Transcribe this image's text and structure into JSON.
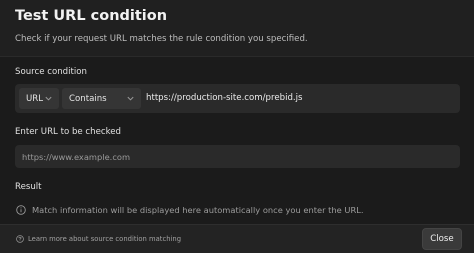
{
  "dialog": {
    "title": "Test URL condition",
    "subtitle": "Check if your request URL matches the rule condition you specified."
  },
  "source_condition": {
    "label": "Source condition",
    "key_select": "URL",
    "operator_select": "Contains",
    "value": "https://production-site.com/prebid.js"
  },
  "url_check": {
    "label": "Enter URL to be checked",
    "placeholder": "https://www.example.com",
    "value": ""
  },
  "result": {
    "label": "Result",
    "info_icon": "info-circle-icon",
    "message": "Match information will be displayed here automatically once you enter the URL."
  },
  "footer": {
    "help_icon": "question-circle-icon",
    "help_link": "Learn more about source condition matching",
    "close_label": "Close"
  }
}
